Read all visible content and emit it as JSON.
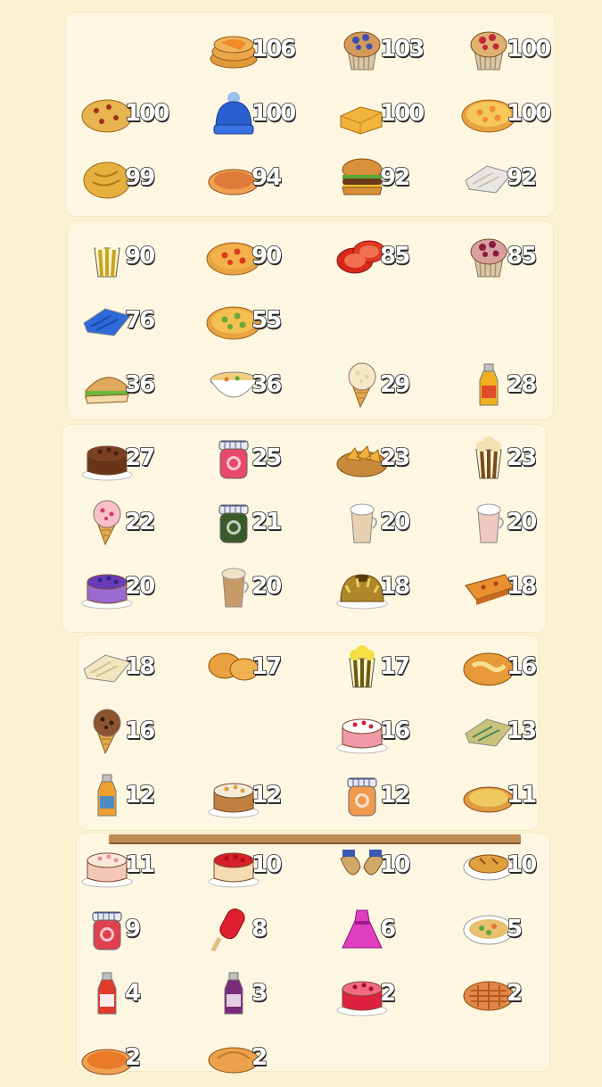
{
  "sections": [
    {
      "items": [
        {
          "icon": "pancakes-icon",
          "count": "106"
        },
        {
          "icon": "blueberry-muffin-icon",
          "count": "103"
        },
        {
          "icon": "raspberry-muffin-icon",
          "count": "100"
        },
        {
          "icon": "cookie-icon",
          "count": "100"
        },
        {
          "icon": "wool-hat-icon",
          "count": "100"
        },
        {
          "icon": "cornbread-icon",
          "count": "100"
        },
        {
          "icon": "cheese-pizza-icon",
          "count": "100"
        },
        {
          "icon": "bread-loaf-icon",
          "count": "99"
        },
        {
          "icon": "pie-icon",
          "count": "94"
        },
        {
          "icon": "hamburger-icon",
          "count": "92"
        },
        {
          "icon": "white-cloth-icon",
          "count": "92"
        }
      ]
    },
    {
      "items": [
        {
          "icon": "popcorn-icon",
          "count": "90"
        },
        {
          "icon": "pepper-pizza-icon",
          "count": "90"
        },
        {
          "icon": "tomato-slices-icon",
          "count": "85"
        },
        {
          "icon": "berry-muffin-icon",
          "count": "85"
        },
        {
          "icon": "blue-sweater-icon",
          "count": "76"
        },
        {
          "icon": "veggie-pizza-icon",
          "count": "55"
        },
        {
          "icon": "sandwich-icon",
          "count": "36"
        },
        {
          "icon": "soup-bowl-icon",
          "count": "36"
        },
        {
          "icon": "vanilla-ice-cream-icon",
          "count": "29"
        },
        {
          "icon": "juice-bottle-icon",
          "count": "28"
        }
      ]
    },
    {
      "items": [
        {
          "icon": "chocolate-cake-icon",
          "count": "27"
        },
        {
          "icon": "cherry-jam-icon",
          "count": "25"
        },
        {
          "icon": "fried-snack-basket-icon",
          "count": "23"
        },
        {
          "icon": "caramel-popcorn-icon",
          "count": "23"
        },
        {
          "icon": "strawberry-ice-cream-icon",
          "count": "22"
        },
        {
          "icon": "blackberry-jam-icon",
          "count": "21"
        },
        {
          "icon": "latte-icon",
          "count": "20"
        },
        {
          "icon": "milkshake-icon",
          "count": "20"
        },
        {
          "icon": "blueberry-cake-icon",
          "count": "20"
        },
        {
          "icon": "coffee-glass-icon",
          "count": "20"
        },
        {
          "icon": "bundt-cake-icon",
          "count": "18"
        },
        {
          "icon": "casserole-icon",
          "count": "18"
        }
      ]
    },
    {
      "items": [
        {
          "icon": "cream-fabric-icon",
          "count": "18"
        },
        {
          "icon": "muffin-stack-icon",
          "count": "17"
        },
        {
          "icon": "lemon-popcorn-icon",
          "count": "17"
        },
        {
          "icon": "cheese-bread-icon",
          "count": "16"
        },
        {
          "icon": "chocolate-chip-cone-icon",
          "count": "16"
        },
        {
          "icon": "strawberry-cake-icon",
          "count": "16"
        },
        {
          "icon": "patterned-scarf-icon",
          "count": "13"
        },
        {
          "icon": "orange-juice-icon",
          "count": "12"
        },
        {
          "icon": "carrot-cake-icon",
          "count": "12"
        },
        {
          "icon": "peach-jam-icon",
          "count": "12"
        },
        {
          "icon": "quiche-icon",
          "count": "11"
        }
      ]
    },
    {
      "items": [
        {
          "icon": "layer-cake-icon",
          "count": "11"
        },
        {
          "icon": "cheesecake-icon",
          "count": "10"
        },
        {
          "icon": "slippers-icon",
          "count": "10"
        },
        {
          "icon": "pot-pie-icon",
          "count": "10"
        },
        {
          "icon": "raspberry-jam-icon",
          "count": "9"
        },
        {
          "icon": "popsicle-icon",
          "count": "8"
        },
        {
          "icon": "pink-dress-icon",
          "count": "6"
        },
        {
          "icon": "stew-dish-icon",
          "count": "5"
        },
        {
          "icon": "tomato-sauce-icon",
          "count": "4"
        },
        {
          "icon": "grape-juice-icon",
          "count": "3"
        },
        {
          "icon": "red-velvet-cake-icon",
          "count": "2"
        },
        {
          "icon": "lattice-pie-icon",
          "count": "2"
        },
        {
          "icon": "pumpkin-pie-icon",
          "count": "2"
        },
        {
          "icon": "apple-pie-icon",
          "count": "2"
        }
      ]
    }
  ]
}
